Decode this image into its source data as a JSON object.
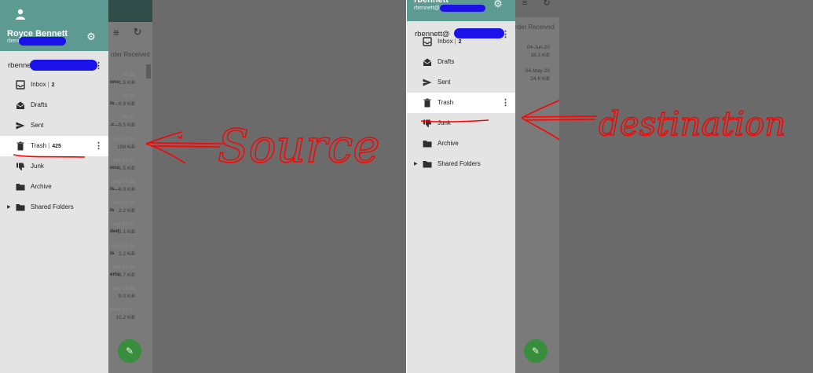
{
  "left": {
    "toolbar_icons": [
      "calendar-icon",
      "contacts-icon",
      "mail-icon",
      "settings-icon",
      "power-icon"
    ],
    "sort_label": "rder Received",
    "messages": [
      {
        "date": "04:06",
        "subject": "ons",
        "size": "1.5 KiB"
      },
      {
        "date": "04:06",
        "subject": "is...",
        "size": "6.9 KiB"
      },
      {
        "date": "00:00",
        "subject": ".c...",
        "size": "8.5 KiB"
      },
      {
        "date": "day 08:00",
        "subject": "",
        "size": "199 KiB"
      },
      {
        "date": "rday 07:57",
        "subject": "ons",
        "size": "1.5 KiB"
      },
      {
        "date": "rday 07:56",
        "subject": "is...",
        "size": "6.9 KiB"
      },
      {
        "date": "rday 04:15",
        "subject": "is",
        "size": "2.2 KiB"
      },
      {
        "date": "rday 03:53",
        "subject": "ded",
        "size": "2.1 KiB"
      },
      {
        "date": "rday 03:45",
        "subject": "is",
        "size": "2.2 KiB"
      },
      {
        "date": "day 00:00",
        "subject": "erts",
        "size": "8.7 KiB"
      },
      {
        "date": "day 18:00",
        "subject": "",
        "size": "9.0 KiB"
      },
      {
        "date": "nday 14:17",
        "subject": "",
        "size": "10.2 KiB"
      }
    ],
    "drawer": {
      "user_name": "Royce Bennett",
      "user_email": "rbennett",
      "account_label": "rbennett",
      "folders": [
        {
          "icon": "inbox-icon",
          "label": "Inbox",
          "count": "2"
        },
        {
          "icon": "drafts-icon",
          "label": "Drafts",
          "count": ""
        },
        {
          "icon": "sent-icon",
          "label": "Sent",
          "count": ""
        },
        {
          "icon": "trash-icon",
          "label": "Trash",
          "count": "425"
        },
        {
          "icon": "junk-icon",
          "label": "Junk",
          "count": ""
        },
        {
          "icon": "archive-icon",
          "label": "Archive",
          "count": ""
        },
        {
          "icon": "folder-icon",
          "label": "Shared Folders",
          "count": ""
        }
      ]
    },
    "annotation": "Source"
  },
  "right": {
    "sort_label": "rder Received",
    "messages": [
      {
        "date": "04-Jun-20",
        "size": "18.3 KiB"
      },
      {
        "date": "04-May-20",
        "size": "24.6 KiB"
      }
    ],
    "drawer": {
      "user_name": "rbennett",
      "user_email": "rbennett@",
      "account_label": "rbennett@",
      "folders": [
        {
          "icon": "inbox-icon",
          "label": "Inbox",
          "count": "2"
        },
        {
          "icon": "drafts-icon",
          "label": "Drafts",
          "count": ""
        },
        {
          "icon": "sent-icon",
          "label": "Sent",
          "count": ""
        },
        {
          "icon": "trash-icon",
          "label": "Trash",
          "count": ""
        },
        {
          "icon": "junk-icon",
          "label": "Junk",
          "count": ""
        },
        {
          "icon": "archive-icon",
          "label": "Archive",
          "count": ""
        },
        {
          "icon": "folder-icon",
          "label": "Shared Folders",
          "count": ""
        }
      ]
    },
    "annotation": "destination"
  },
  "colors": {
    "drawer_header": "#5d9a92",
    "toolbar": "#324c4a",
    "fab": "#388e3c",
    "annotation_red": "#ff0000",
    "redaction_blue": "#1a12e8"
  }
}
